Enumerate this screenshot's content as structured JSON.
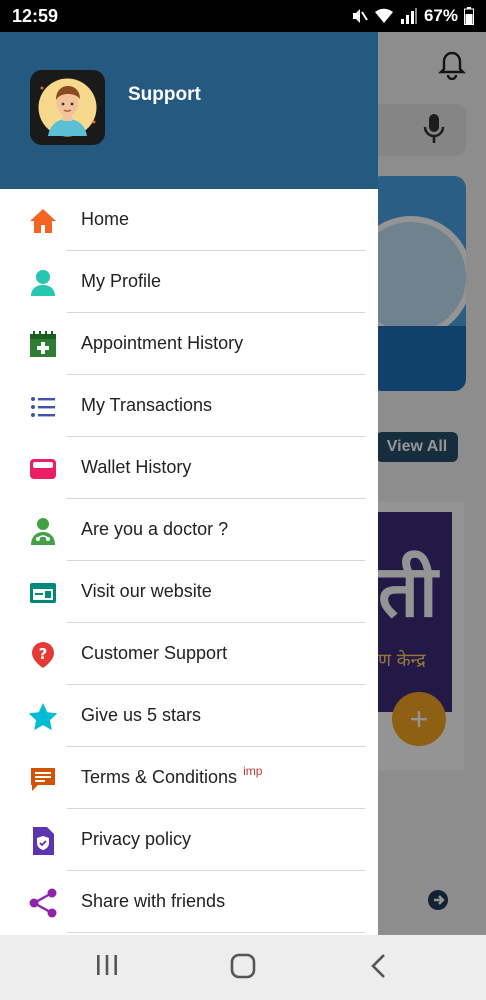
{
  "status": {
    "time": "12:59",
    "battery": "67%"
  },
  "drawer": {
    "title": "Support",
    "items": [
      {
        "label": "Home",
        "icon": "home-icon",
        "color": "#f26522"
      },
      {
        "label": "My Profile",
        "icon": "person-icon",
        "color": "#26c6b0"
      },
      {
        "label": "Appointment History",
        "icon": "calendar-plus-icon",
        "color": "#2e7d32"
      },
      {
        "label": "My Transactions",
        "icon": "list-icon",
        "color": "#3f51b5"
      },
      {
        "label": "Wallet History",
        "icon": "wallet-icon",
        "color": "#e91e63"
      },
      {
        "label": "Are you a doctor ?",
        "icon": "doctor-icon",
        "color": "#43a047"
      },
      {
        "label": "Visit our website",
        "icon": "website-icon",
        "color": "#00897b"
      },
      {
        "label": "Customer Support",
        "icon": "help-icon",
        "color": "#e53935"
      },
      {
        "label": "Give us 5 stars",
        "icon": "star-icon",
        "color": "#00bcd4"
      },
      {
        "label": "Terms & Conditions",
        "icon": "chat-icon",
        "color": "#d35400",
        "sup": "imp"
      },
      {
        "label": "Privacy policy",
        "icon": "shield-document-icon",
        "color": "#5e35b1"
      },
      {
        "label": "Share with friends",
        "icon": "share-icon",
        "color": "#8e24aa"
      }
    ]
  },
  "background": {
    "view_all": "View All",
    "poster_big": "ती",
    "poster_small": "ण केन्द्र",
    "fab": "+"
  }
}
